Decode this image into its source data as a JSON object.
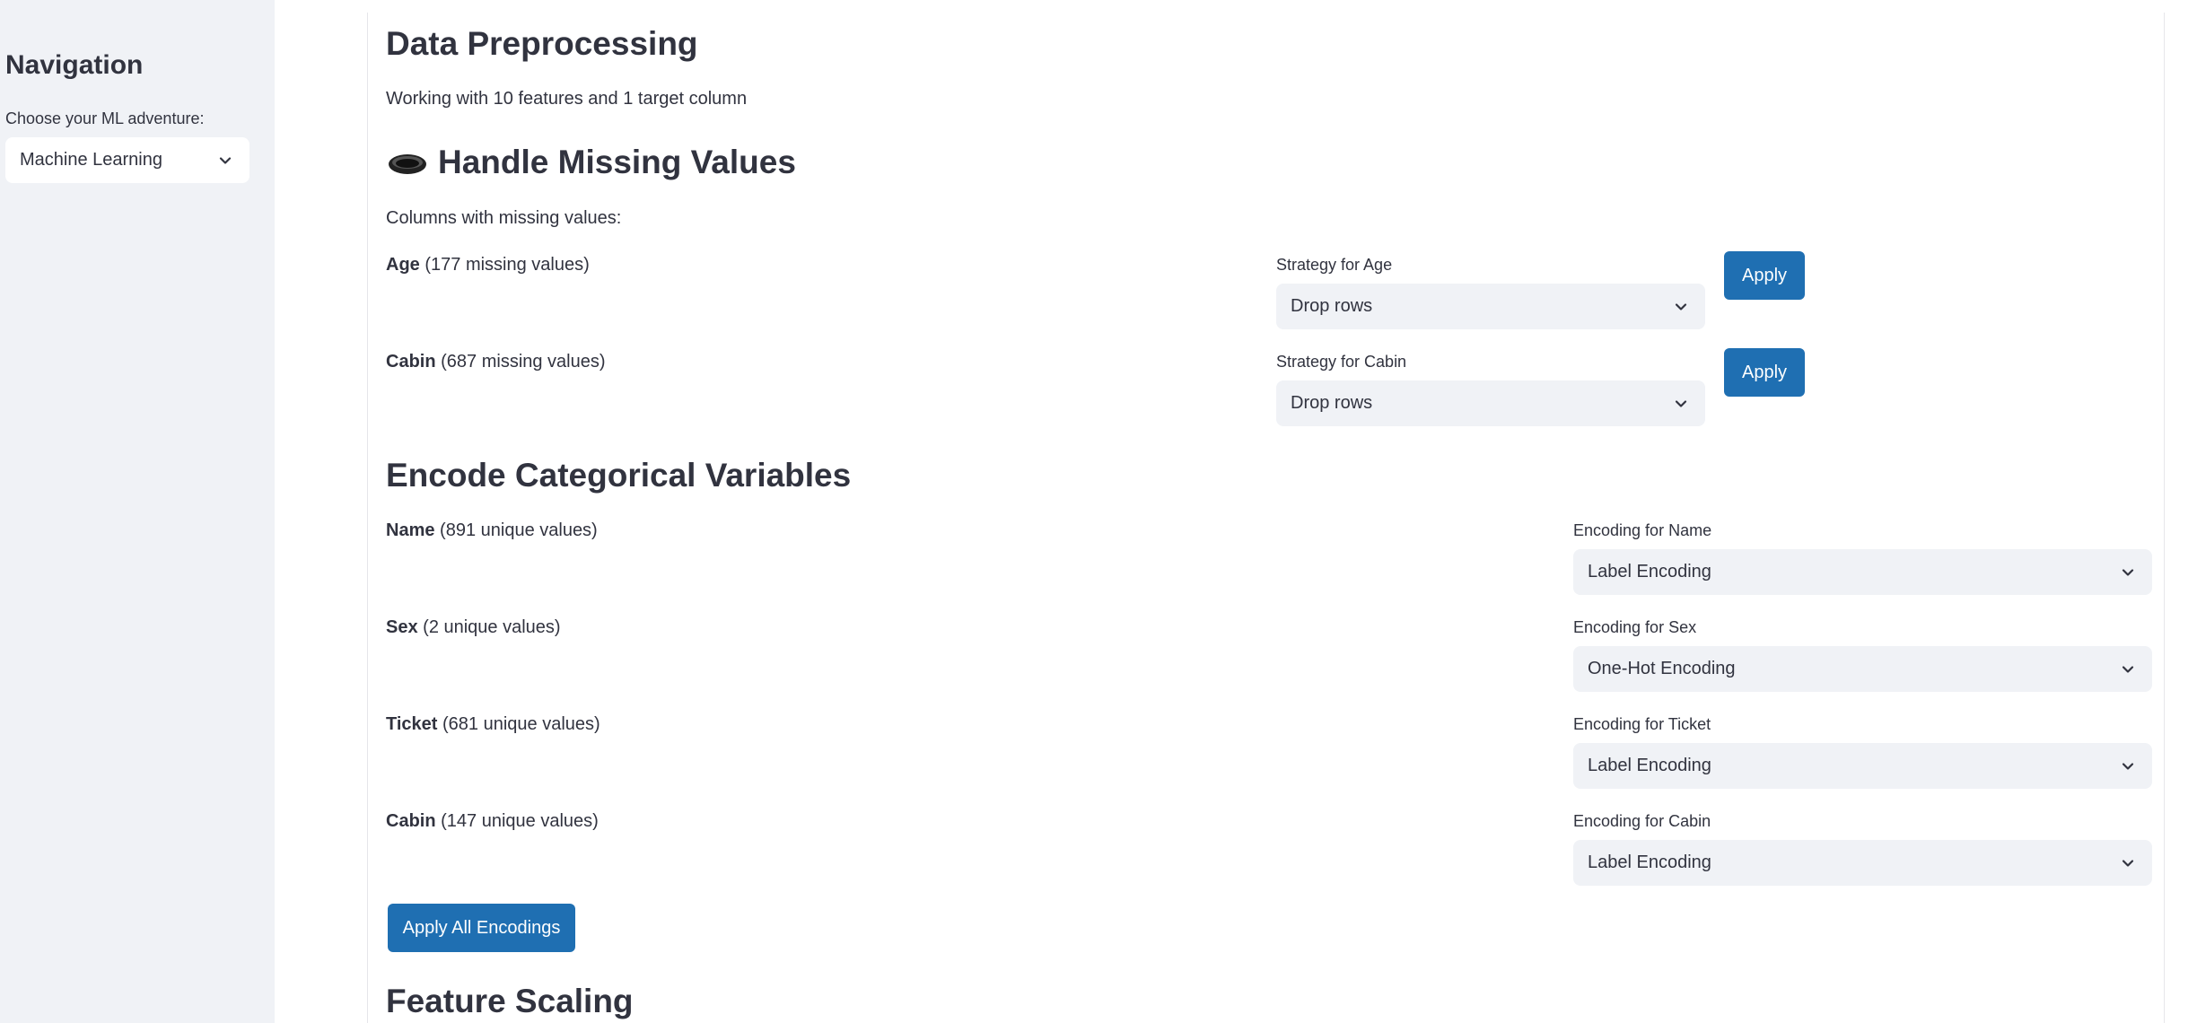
{
  "sidebar": {
    "title": "Navigation",
    "label": "Choose your ML adventure:",
    "selected": "Machine Learning"
  },
  "main": {
    "title": "Data Preprocessing",
    "subtitle": "Working with 10 features and 1 target column",
    "missing": {
      "heading": "Handle Missing Values",
      "intro": "Columns with missing values:",
      "rows": [
        {
          "name": "Age",
          "info": "(177 missing values)",
          "label": "Strategy for Age",
          "value": "Drop rows",
          "button": "Apply"
        },
        {
          "name": "Cabin",
          "info": "(687 missing values)",
          "label": "Strategy for Cabin",
          "value": "Drop rows",
          "button": "Apply"
        }
      ]
    },
    "encode": {
      "heading": "Encode Categorical Variables",
      "rows": [
        {
          "name": "Name",
          "info": "(891 unique values)",
          "label": "Encoding for Name",
          "value": "Label Encoding"
        },
        {
          "name": "Sex",
          "info": "(2 unique values)",
          "label": "Encoding for Sex",
          "value": "One-Hot Encoding"
        },
        {
          "name": "Ticket",
          "info": "(681 unique values)",
          "label": "Encoding for Ticket",
          "value": "Label Encoding"
        },
        {
          "name": "Cabin",
          "info": "(147 unique values)",
          "label": "Encoding for Cabin",
          "value": "Label Encoding"
        }
      ],
      "apply_all": "Apply All Encodings"
    },
    "scaling": {
      "heading": "Feature Scaling"
    }
  }
}
